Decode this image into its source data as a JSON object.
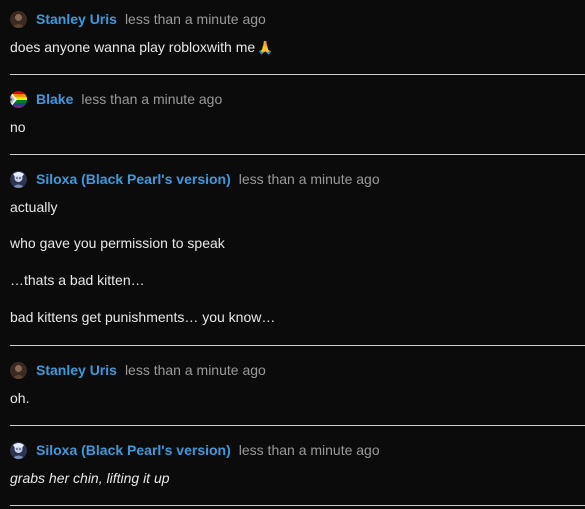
{
  "messages": [
    {
      "username": "Stanley Uris",
      "avatar_icon": "stanley-avatar-icon",
      "timestamp": "less than a minute ago",
      "lines": [
        "does anyone wanna play robloxwith me"
      ],
      "emoji": "🙏"
    },
    {
      "username": "Blake",
      "avatar_icon": "pride-flag-avatar-icon",
      "timestamp": "less than a minute ago",
      "lines": [
        "no"
      ]
    },
    {
      "username": "Siloxa (Black Pearl's version)",
      "avatar_icon": "siloxa-avatar-icon",
      "timestamp": "less than a minute ago",
      "lines": [
        "actually",
        "who gave you permission to speak",
        "…thats a bad kitten…",
        "bad kittens get punishments… you know…"
      ]
    },
    {
      "username": "Stanley Uris",
      "avatar_icon": "stanley-avatar-icon",
      "timestamp": "less than a minute ago",
      "lines": [
        "oh."
      ]
    },
    {
      "username": "Siloxa (Black Pearl's version)",
      "avatar_icon": "siloxa-avatar-icon",
      "timestamp": "less than a minute ago",
      "lines": [
        "grabs her chin, lifting it up"
      ]
    }
  ],
  "colors": {
    "background": "#0b0b0c",
    "username": "#3a9bdc",
    "timestamp": "#9a9a9a",
    "text": "#e8e8e8",
    "divider": "#cfcfcf"
  }
}
